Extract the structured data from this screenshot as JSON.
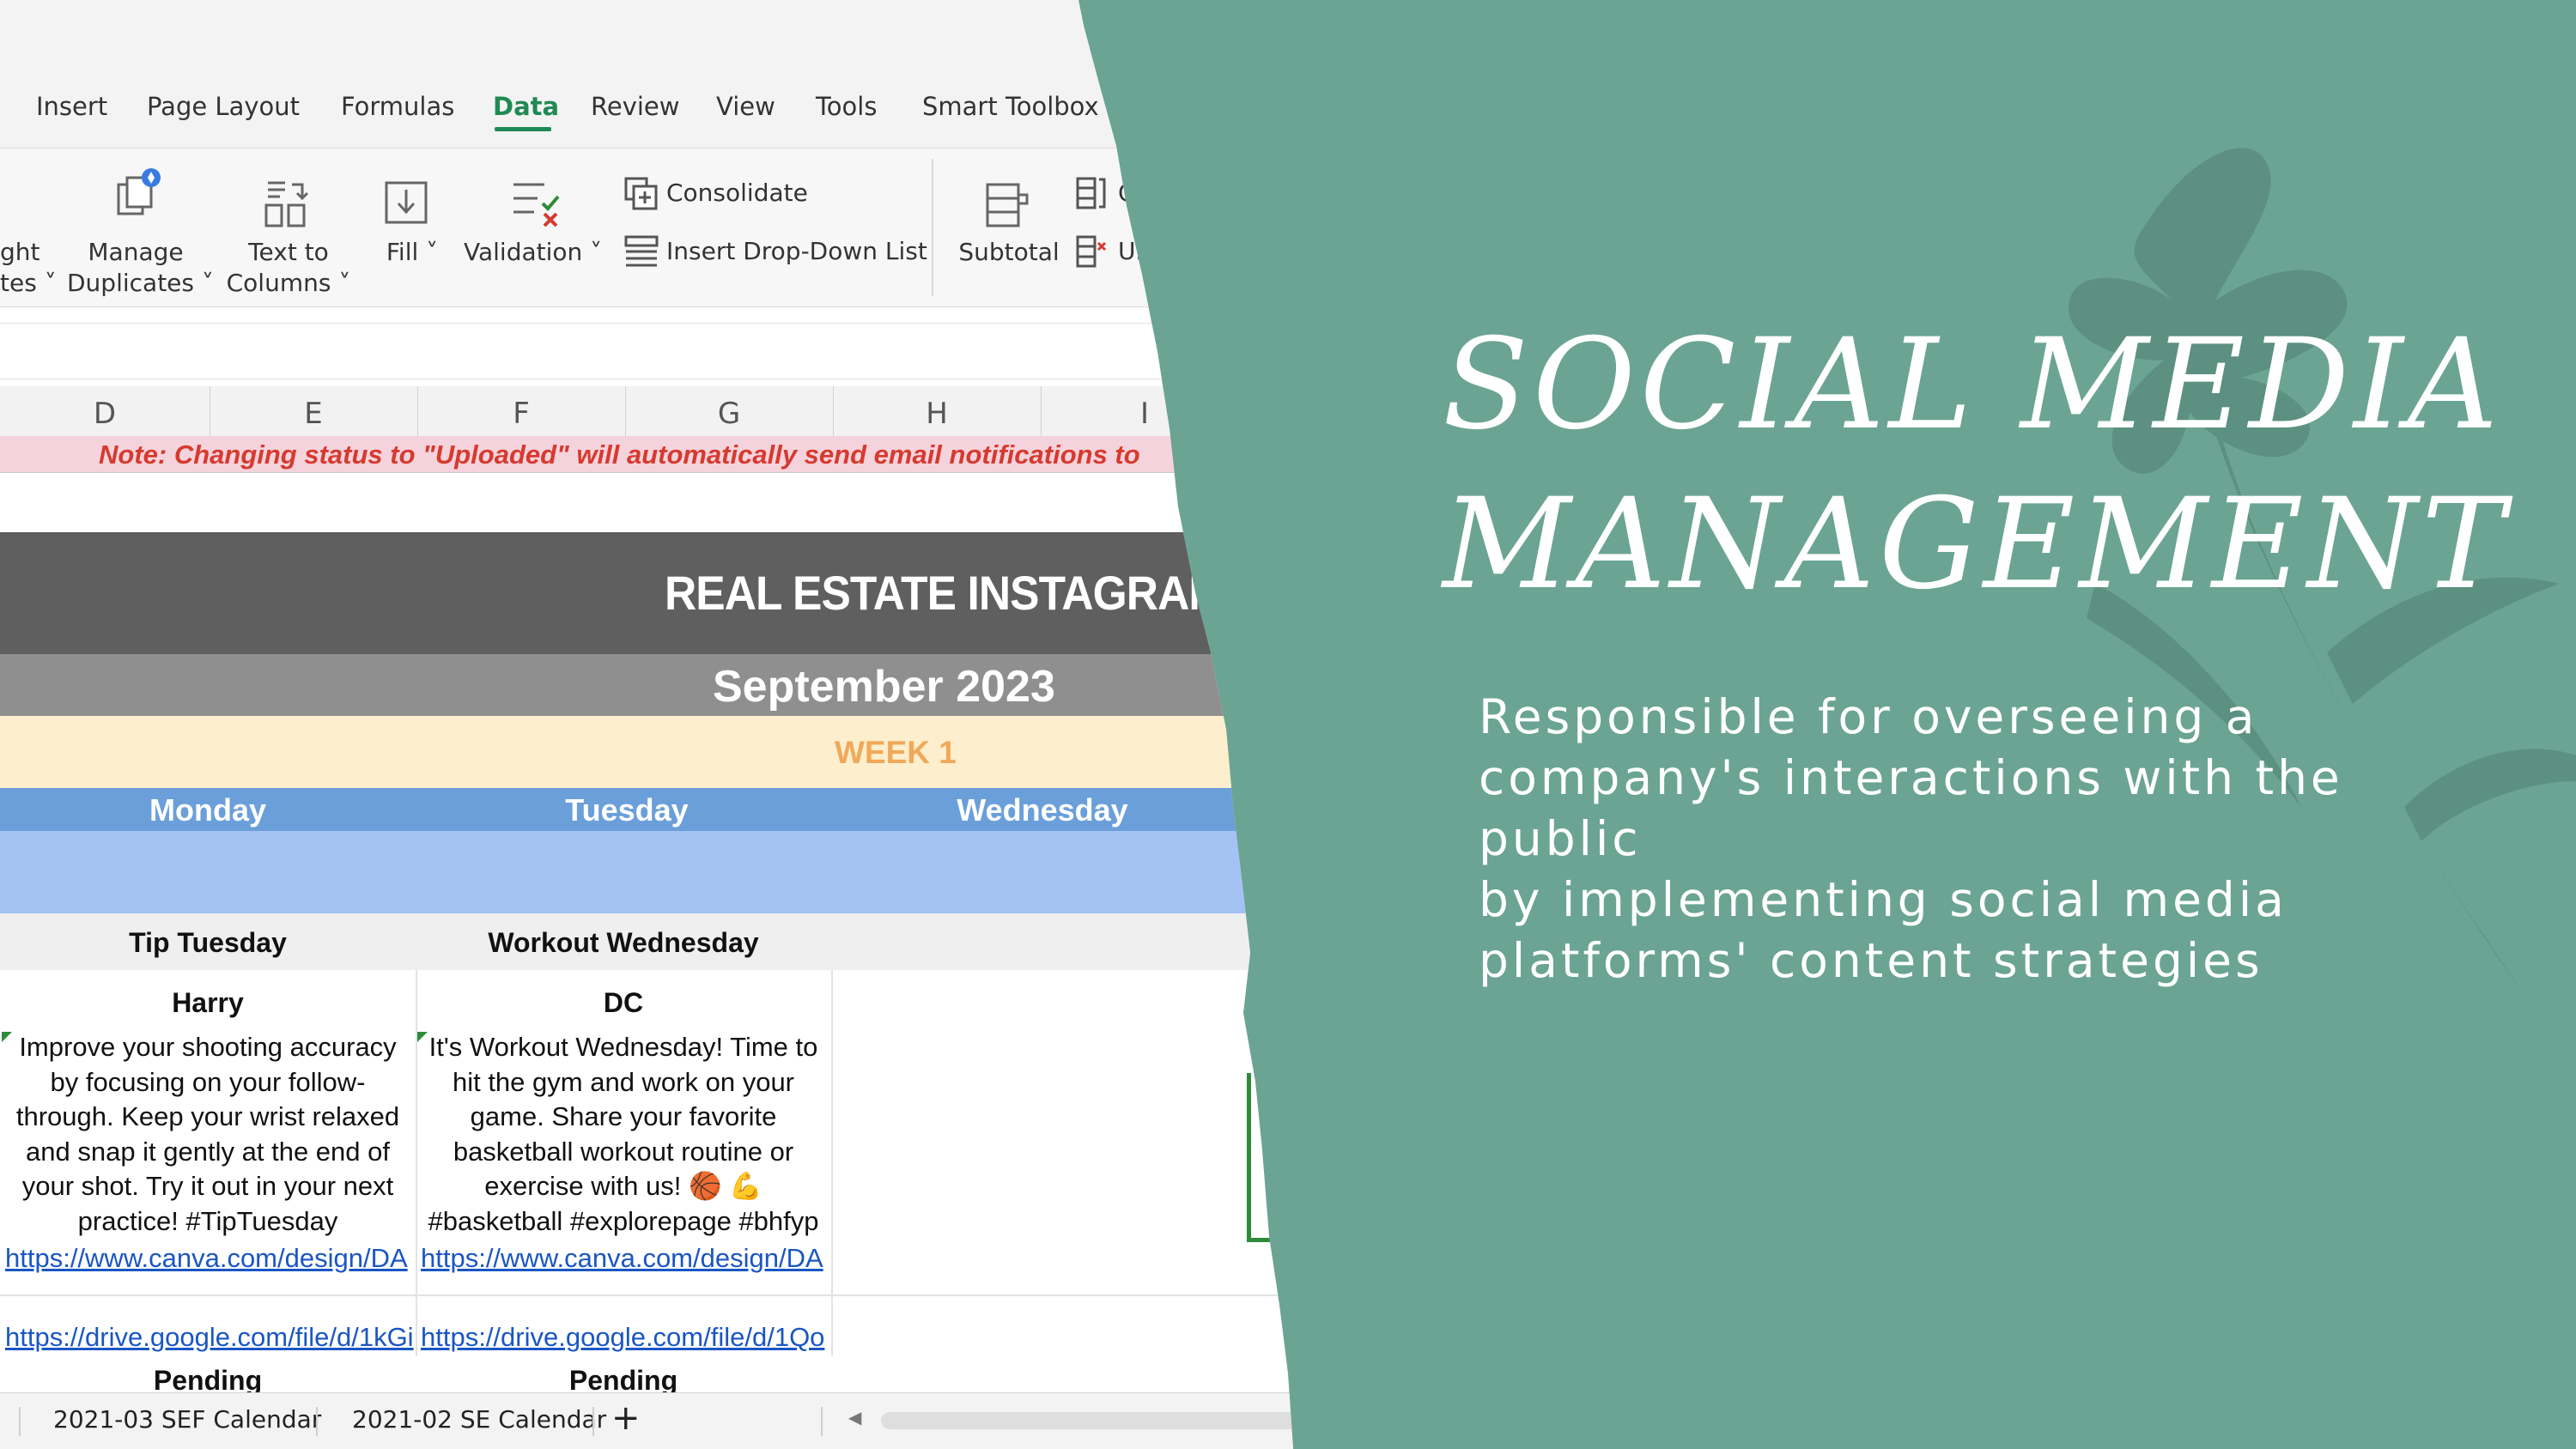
{
  "slide": {
    "title_lines": [
      "SOCIAL MEDIA",
      "MANAGEMENT"
    ],
    "description_lines": [
      "Responsible for overseeing a",
      "company's interactions with the public",
      "by implementing social media",
      "platforms' content strategies"
    ],
    "background_color": "#6ba493"
  },
  "app": {
    "menu": {
      "insert": "Insert",
      "page_layout": "Page Layout",
      "formulas": "Formulas",
      "data": "Data",
      "review": "Review",
      "view": "View",
      "tools": "Tools",
      "smart_toolbox": "Smart Toolbox"
    },
    "ribbon": {
      "highlight_partial_1": "ght",
      "highlight_partial_2": "tes",
      "manage_duplicates_1": "Manage",
      "manage_duplicates_2": "Duplicates",
      "text_to_columns_1": "Text to",
      "text_to_columns_2": "Columns",
      "fill": "Fill",
      "validation": "Validation",
      "consolidate": "Consolidate",
      "insert_dropdown_list": "Insert Drop-Down List",
      "subtotal": "Subtotal",
      "group_partial": "G",
      "ungroup_partial": "Un"
    },
    "columns": [
      "D",
      "E",
      "F",
      "G",
      "H",
      "I"
    ],
    "note": "Note: Changing status to \"Uploaded\" will automatically send email notifications to",
    "banner_title": "REAL ESTATE INSTAGRAM",
    "month": "September 2023",
    "week": "WEEK 1",
    "days": [
      "Monday",
      "Tuesday",
      "Wednesday"
    ],
    "posts": [
      {
        "theme": "Tip Tuesday",
        "author": "Harry",
        "text_lines": [
          "Improve your shooting accuracy",
          "by focusing on your follow-",
          "through. Keep your wrist relaxed",
          "and snap it gently at the end of",
          "your shot. Try it out in your next",
          "practice! #TipTuesday"
        ],
        "canva_link": "https://www.canva.com/design/DA",
        "drive_link": "https://drive.google.com/file/d/1kGi",
        "status": "Pending"
      },
      {
        "theme": "Workout Wednesday",
        "author": "DC",
        "text_lines": [
          "It's Workout Wednesday! Time to",
          "hit the gym and work on your",
          "game. Share your favorite",
          "basketball workout routine or",
          "exercise with us! 🏀 💪",
          "#basketball #explorepage #bhfyp"
        ],
        "canva_link": "https://www.canva.com/design/DA",
        "drive_link": "https://drive.google.com/file/d/1Qo",
        "status": "Pending"
      }
    ],
    "sheet_tabs": [
      "2021-03 SEF Calendar",
      "2021-02 SE Calendar"
    ],
    "add_sheet_symbol": "+"
  }
}
